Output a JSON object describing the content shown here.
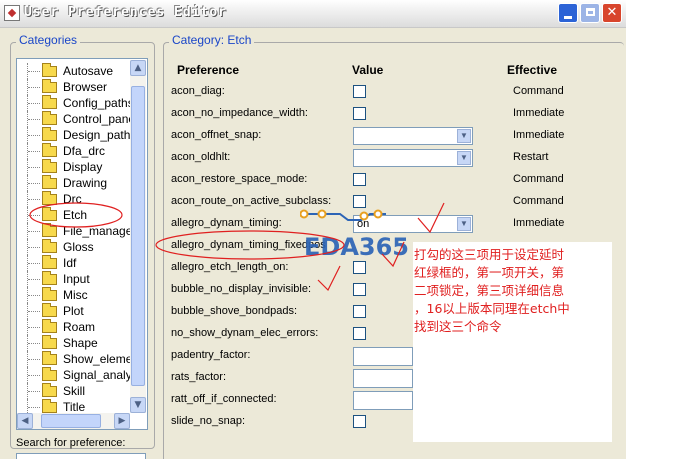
{
  "window": {
    "title": "User Preferences Editor",
    "icon": "app-icon",
    "controls": {
      "minimize": "minimize",
      "maximize": "maximize",
      "close": "✕"
    }
  },
  "categories": {
    "legend": "Categories",
    "items": [
      {
        "label": "Autosave"
      },
      {
        "label": "Browser"
      },
      {
        "label": "Config_paths"
      },
      {
        "label": "Control_panel"
      },
      {
        "label": "Design_paths"
      },
      {
        "label": "Dfa_drc"
      },
      {
        "label": "Display"
      },
      {
        "label": "Drawing"
      },
      {
        "label": "Drc"
      },
      {
        "label": "Etch"
      },
      {
        "label": "File_managem"
      },
      {
        "label": "Gloss"
      },
      {
        "label": "Idf"
      },
      {
        "label": "Input"
      },
      {
        "label": "Misc"
      },
      {
        "label": "Plot"
      },
      {
        "label": "Roam"
      },
      {
        "label": "Shape"
      },
      {
        "label": "Show_elemen"
      },
      {
        "label": "Signal_analysi"
      },
      {
        "label": "Skill"
      },
      {
        "label": "Title"
      }
    ],
    "selected": "Etch"
  },
  "search": {
    "label": "Search for preference:",
    "value": ""
  },
  "category": {
    "prefix": "Category:",
    "name": "Etch"
  },
  "table": {
    "headers": {
      "preference": "Preference",
      "value": "Value",
      "effective": "Effective"
    },
    "rows": [
      {
        "name": "acon_diag:",
        "control": "checkbox",
        "effective": "Command"
      },
      {
        "name": "acon_no_impedance_width:",
        "control": "checkbox",
        "effective": "Immediate"
      },
      {
        "name": "acon_offnet_snap:",
        "control": "combo",
        "value": "",
        "effective": "Immediate"
      },
      {
        "name": "acon_oldhlt:",
        "control": "combo",
        "value": "",
        "effective": "Restart"
      },
      {
        "name": "acon_restore_space_mode:",
        "control": "checkbox",
        "effective": "Command"
      },
      {
        "name": "acon_route_on_active_subclass:",
        "control": "checkbox",
        "effective": "Command"
      },
      {
        "name": "allegro_dynam_timing:",
        "control": "combo",
        "value": "on",
        "effective": "Immediate"
      },
      {
        "name": "allegro_dynam_timing_fixedpos",
        "control": "none",
        "effective": ""
      },
      {
        "name": "allegro_etch_length_on:",
        "control": "checkbox",
        "effective": ""
      },
      {
        "name": "bubble_no_display_invisible:",
        "control": "checkbox",
        "effective": ""
      },
      {
        "name": "bubble_shove_bondpads:",
        "control": "checkbox",
        "effective": ""
      },
      {
        "name": "no_show_dynam_elec_errors:",
        "control": "checkbox",
        "effective": ""
      },
      {
        "name": "padentry_factor:",
        "control": "text",
        "effective": ""
      },
      {
        "name": "rats_factor:",
        "control": "text",
        "effective": ""
      },
      {
        "name": "ratt_off_if_connected:",
        "control": "text",
        "effective": ""
      },
      {
        "name": "slide_no_snap:",
        "control": "checkbox",
        "effective": ""
      }
    ]
  },
  "watermark": {
    "text": "EDA365"
  },
  "annotation": {
    "lines": [
      "打勾的这三项用于设定延时",
      "红绿框的，第一项开关，第",
      "二项锁定，第三项详细信息",
      "，16以上版本同理在etch中",
      "找到这三个命令"
    ],
    "color": "#e02020"
  },
  "colors": {
    "legend": "#1a46c8",
    "accent": "#2c63d6",
    "annotation": "#e02020",
    "watermark": "#2c64b6"
  }
}
